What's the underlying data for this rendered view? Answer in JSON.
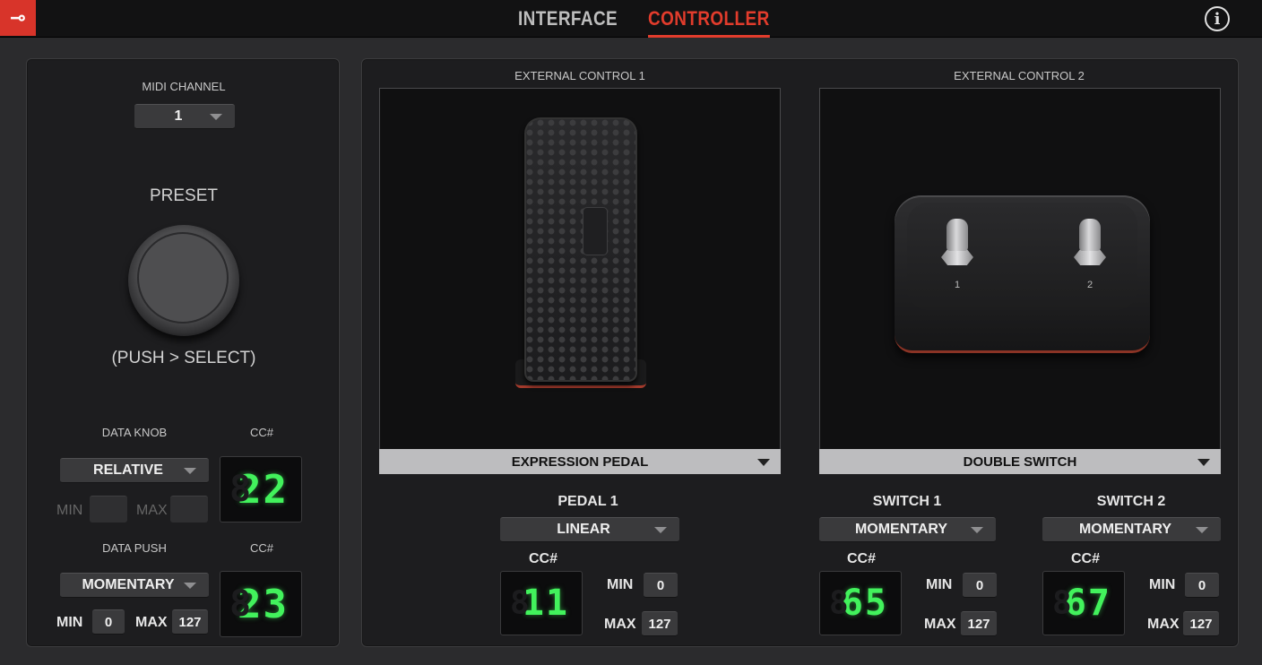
{
  "header": {
    "logo_glyph": "⊸",
    "tabs": [
      {
        "label": "INTERFACE",
        "active": false
      },
      {
        "label": "CONTROLLER",
        "active": true
      }
    ],
    "info_glyph": "i"
  },
  "left": {
    "midi_channel_label": "MIDI CHANNEL",
    "midi_channel_value": "1",
    "preset_label": "PRESET",
    "preset_hint": "(PUSH > SELECT)",
    "data_knob": {
      "label": "DATA KNOB",
      "mode": "RELATIVE",
      "cc_label": "CC#",
      "cc_value": "22",
      "min_label": "MIN",
      "max_label": "MAX",
      "min_value": "",
      "max_value": ""
    },
    "data_push": {
      "label": "DATA PUSH",
      "mode": "MOMENTARY",
      "cc_label": "CC#",
      "cc_value": "23",
      "min_label": "MIN",
      "max_label": "MAX",
      "min_value": "0",
      "max_value": "127"
    }
  },
  "ext1": {
    "title": "EXTERNAL CONTROL 1",
    "device": "EXPRESSION PEDAL",
    "pedal": {
      "label": "PEDAL 1",
      "mode": "LINEAR",
      "cc_label": "CC#",
      "cc_value": "11",
      "min_label": "MIN",
      "max_label": "MAX",
      "min_value": "0",
      "max_value": "127"
    }
  },
  "ext2": {
    "title": "EXTERNAL CONTROL 2",
    "device": "DOUBLE SWITCH",
    "switch_numbers": [
      "1",
      "2"
    ],
    "switch1": {
      "label": "SWITCH 1",
      "mode": "MOMENTARY",
      "cc_label": "CC#",
      "cc_value": "65",
      "min_label": "MIN",
      "max_label": "MAX",
      "min_value": "0",
      "max_value": "127"
    },
    "switch2": {
      "label": "SWITCH 2",
      "mode": "MOMENTARY",
      "cc_label": "CC#",
      "cc_value": "67",
      "min_label": "MIN",
      "max_label": "MAX",
      "min_value": "0",
      "max_value": "127"
    }
  },
  "colors": {
    "accent": "#e23c2c",
    "lcd_green": "#42f25c",
    "panel": "#1d1d1f",
    "background": "#2b2b2d"
  }
}
